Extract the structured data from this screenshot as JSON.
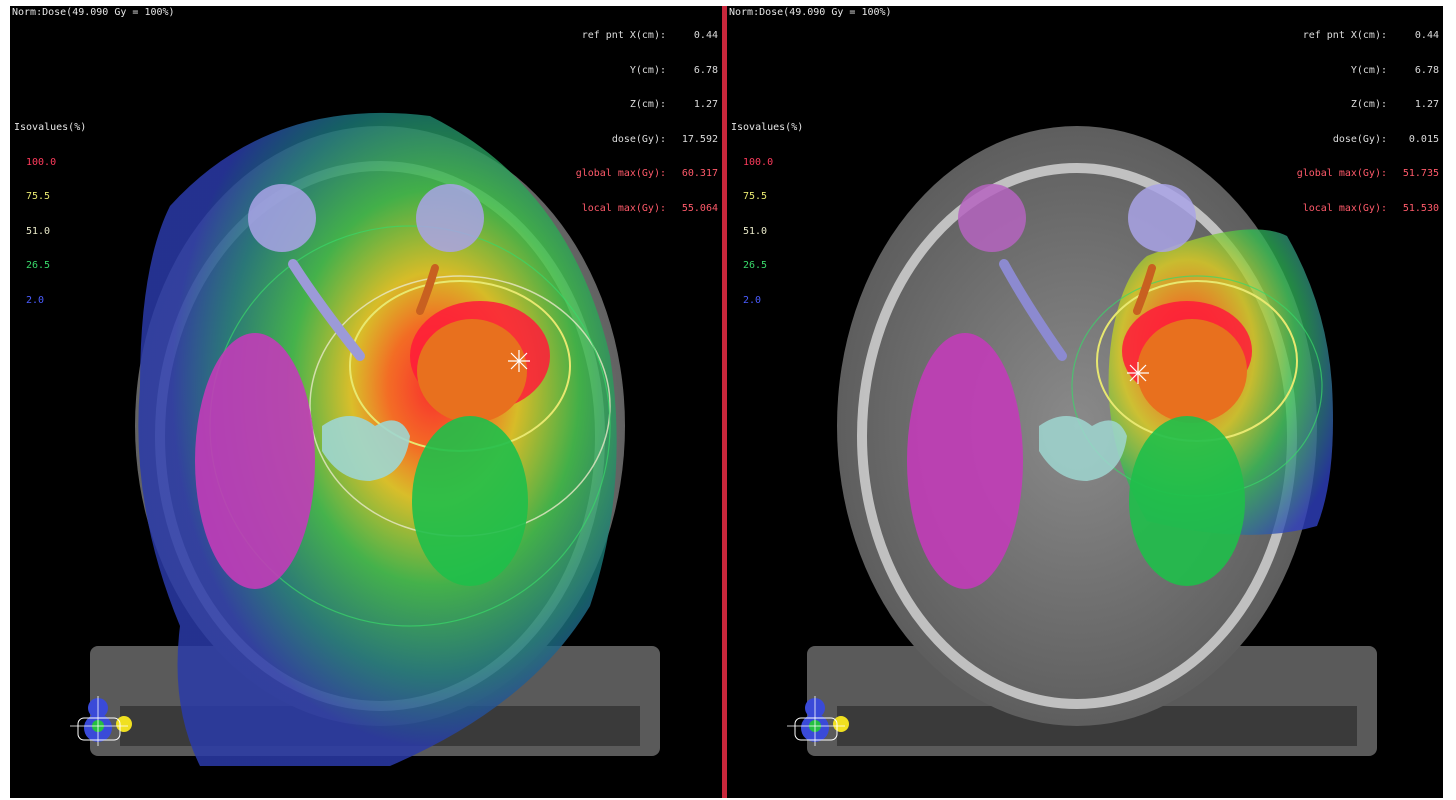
{
  "left_view": {
    "norm_label": "Norm:Dose(49.090 Gy = 100%)",
    "readout": {
      "rows": [
        {
          "label": "ref pnt X(cm):",
          "value": "0.44"
        },
        {
          "label": "Y(cm):",
          "value": "6.78"
        },
        {
          "label": "Z(cm):",
          "value": "1.27"
        },
        {
          "label": "dose(Gy):",
          "value": "17.592"
        }
      ],
      "global_max_label": "global max(Gy):",
      "global_max_value": "60.317",
      "local_max_label": "local max(Gy):",
      "local_max_value": "55.064"
    },
    "legend": {
      "title": "Isovalues(%)",
      "items": [
        {
          "value": "100.0",
          "color": "#ff3b5c"
        },
        {
          "value": "75.5",
          "color": "#e8e870"
        },
        {
          "value": "51.0",
          "color": "#e8e8c8"
        },
        {
          "value": "26.5",
          "color": "#39d86a"
        },
        {
          "value": "2.0",
          "color": "#4a5cff"
        }
      ]
    }
  },
  "right_view": {
    "norm_label": "Norm:Dose(49.090 Gy = 100%)",
    "readout": {
      "rows": [
        {
          "label": "ref pnt X(cm):",
          "value": "0.44"
        },
        {
          "label": "Y(cm):",
          "value": "6.78"
        },
        {
          "label": "Z(cm):",
          "value": "1.27"
        },
        {
          "label": "dose(Gy):",
          "value": "0.015"
        }
      ],
      "global_max_label": "global max(Gy):",
      "global_max_value": "51.735",
      "local_max_label": "local max(Gy):",
      "local_max_value": "51.530"
    },
    "legend": {
      "title": "Isovalues(%)",
      "items": [
        {
          "value": "100.0",
          "color": "#ff3b5c"
        },
        {
          "value": "75.5",
          "color": "#e8e870"
        },
        {
          "value": "51.0",
          "color": "#e8e8c8"
        },
        {
          "value": "26.5",
          "color": "#39d86a"
        },
        {
          "value": "2.0",
          "color": "#4a5cff"
        }
      ]
    }
  },
  "colors": {
    "frame_accent": "#c8273b",
    "ptv": "#e8701e",
    "hot_spot": "#ff1a3a",
    "brainstem": "#9fd6d0",
    "temporal_lobe": "#c23cb8",
    "optic_structure": "#a9a3e6",
    "hippocampus": "#1fbf4a"
  },
  "icons": {
    "orientation": "orientation-cube-icon",
    "crosshair": "crosshair-icon"
  }
}
